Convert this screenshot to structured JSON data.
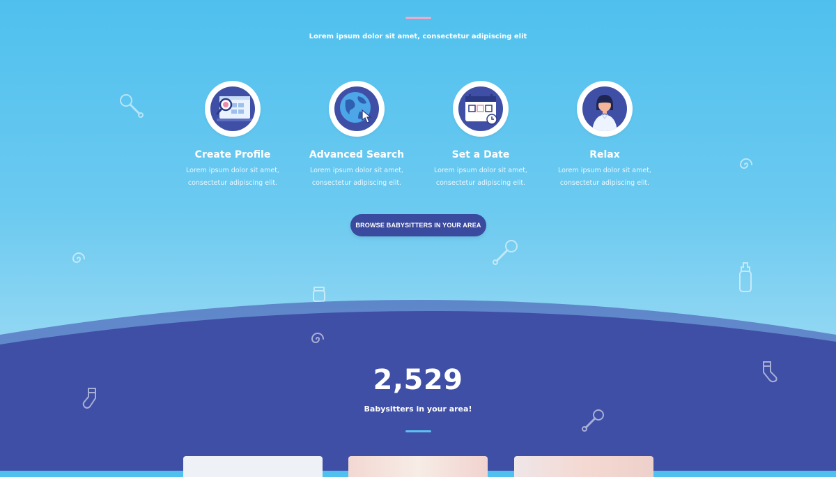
{
  "header": {
    "subtitle": "Lorem ipsum dolor sit amet, consectetur adipiscing elit"
  },
  "steps": [
    {
      "title": "Create Profile",
      "line1": "Lorem ipsum dolor sit amet,",
      "line2": "consectetur adipiscing elit.",
      "icon": "profile-search-icon"
    },
    {
      "title": "Advanced Search",
      "line1": "Lorem ipsum dolor sit amet,",
      "line2": "consectetur adipiscing elit.",
      "icon": "globe-pointer-icon"
    },
    {
      "title": "Set a Date",
      "line1": "Lorem ipsum dolor sit amet,",
      "line2": "consectetur adipiscing elit.",
      "icon": "calendar-icon"
    },
    {
      "title": "Relax",
      "line1": "Lorem ipsum dolor sit amet,",
      "line2": "consectetur adipiscing elit.",
      "icon": "person-avatar-icon"
    }
  ],
  "cta": {
    "label": "BROWSE BABYSITTERS IN YOUR AREA"
  },
  "stats": {
    "count": "2,529",
    "label": "Babysitters in your area!"
  },
  "colors": {
    "sky": "#4fc0ee",
    "navy": "#3f4fa6",
    "button": "#3a4a9f",
    "accent_pink": "#f2a9c8",
    "accent_blue": "#5bc1ef"
  }
}
